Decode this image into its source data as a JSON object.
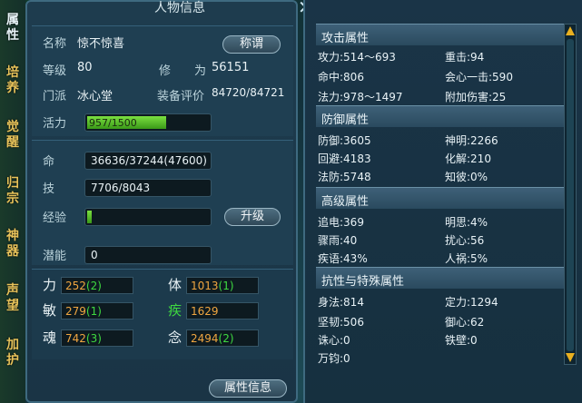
{
  "tabs": [
    "属性",
    "培养",
    "觉醒",
    "归宗",
    "神器",
    "声望",
    "加护"
  ],
  "window": {
    "title": "人物信息"
  },
  "info": {
    "name_label": "名称",
    "name": "惊不惊喜",
    "title_btn": "称谓",
    "level_label": "等级",
    "level": "80",
    "cultivation_label": "修　　为",
    "cultivation": "56151",
    "school_label": "门派",
    "school": "冰心堂",
    "rating_label": "装备评价",
    "rating": "84720/84721",
    "vitality_label": "活力",
    "vitality": "957/1500",
    "vitality_pct": 63.8
  },
  "life": {
    "label": "命",
    "value": "36636/37244(47600)"
  },
  "skill": {
    "label": "技",
    "value": "7706/8043"
  },
  "exp": {
    "label": "经验",
    "upgrade_btn": "升级",
    "pct": 3
  },
  "potential": {
    "label": "潜能",
    "value": "0"
  },
  "stats": [
    {
      "label": "力",
      "base": "252",
      "add": "(2)"
    },
    {
      "label": "体",
      "base": "1013",
      "add": "(1)"
    },
    {
      "label": "敏",
      "base": "279",
      "add": "(1)"
    },
    {
      "label": "疾",
      "base": "1629",
      "add": ""
    },
    {
      "label": "魂",
      "base": "742",
      "add": "(3)"
    },
    {
      "label": "念",
      "base": "2494",
      "add": "(2)"
    }
  ],
  "attr_btn": "属性信息",
  "attack": {
    "header": "攻击属性",
    "rows": [
      [
        "攻力:514～693",
        "重击:94"
      ],
      [
        "命中:806",
        "会心一击:590"
      ],
      [
        "法力:978～1497",
        "附加伤害:25"
      ]
    ]
  },
  "defense": {
    "header": "防御属性",
    "rows": [
      [
        "防御:3605",
        "神明:2266"
      ],
      [
        "回避:4183",
        "化解:210"
      ],
      [
        "法防:5748",
        "知彼:0%"
      ]
    ]
  },
  "advanced": {
    "header": "高级属性",
    "rows": [
      [
        "追电:369",
        "明思:4%"
      ],
      [
        "骤雨:40",
        "扰心:56"
      ],
      [
        "疾语:43%",
        "人祸:5%"
      ]
    ]
  },
  "resist": {
    "header": "抗性与特殊属性",
    "rows": [
      [
        "身法:814",
        "定力:1294"
      ],
      [
        "坚韧:506",
        "御心:62"
      ],
      [
        "诛心:0",
        "铁壁:0"
      ],
      [
        "万钧:0",
        ""
      ]
    ]
  }
}
